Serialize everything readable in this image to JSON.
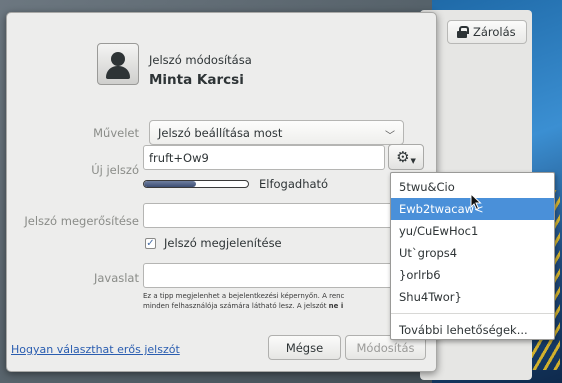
{
  "lock_button": {
    "label": "Zárolás"
  },
  "header": {
    "subtitle": "Jelszó módosítása",
    "username": "Minta Karcsi"
  },
  "form": {
    "action_label": "Művelet",
    "action_value": "Jelszó beállítása most",
    "new_password_label": "Új jelszó",
    "new_password_value": "fruft+Ow9",
    "strength_label": "Elfogadható",
    "strength_fraction": 0.5,
    "confirm_label": "Jelszó megerősítése",
    "confirm_value": "",
    "show_password_label": "Jelszó megjelenítése",
    "show_password_checked": true,
    "hint_label": "Javaslat",
    "hint_value": "",
    "hint_help_line1": "Ez a tipp megjelenhet a bejelentkezési képernyőn. A renc",
    "hint_help_line2_pre": "minden felhasználója számára látható lesz. A jelszót ",
    "hint_help_line2_bold": "ne i"
  },
  "footer": {
    "help_link": "Hogyan választhat erős jelszót",
    "cancel_label": "Mégse",
    "change_label": "Módosítás"
  },
  "suggestions": {
    "items": [
      "5twu&Cio",
      "Ewb2twacaw<",
      "yu/CuEwHoc1",
      "Ut`grops4",
      "}orlrb6",
      "Shu4Twor}"
    ],
    "selected_index": 1,
    "more_label": "További lehetőségek..."
  },
  "colors": {
    "accent": "#4a90d9",
    "link": "#2a5db0"
  },
  "icons": {
    "lock": "lock-icon",
    "avatar": "user-avatar-icon",
    "gear": "gear-icon",
    "chevron": "chevron-down-icon",
    "check": "check-icon"
  }
}
